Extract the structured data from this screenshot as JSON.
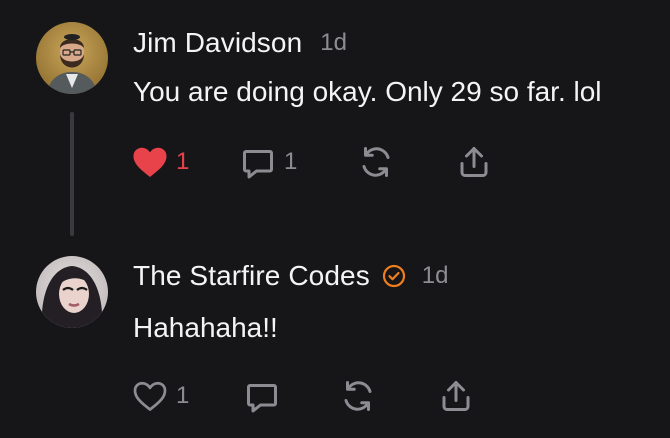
{
  "colors": {
    "background": "#161618",
    "text": "#f4f4f6",
    "muted": "#8c8c92",
    "like_active": "#e8424b",
    "verified": "#f07d1e",
    "thread_line": "#3a3a3e"
  },
  "posts": [
    {
      "author": "Jim Davidson",
      "time": "1d",
      "text": "You are doing okay. Only 29 so far. lol",
      "avatar_icon": "avatar-photo",
      "liked": true,
      "like_count": "1",
      "reply_count": "1",
      "repost_count": "",
      "verified": false
    },
    {
      "author": "The Starfire Codes",
      "time": "1d",
      "text": "Hahahaha!!",
      "avatar_icon": "avatar-photo",
      "liked": false,
      "like_count": "1",
      "reply_count": "",
      "repost_count": "",
      "verified": true
    }
  ]
}
